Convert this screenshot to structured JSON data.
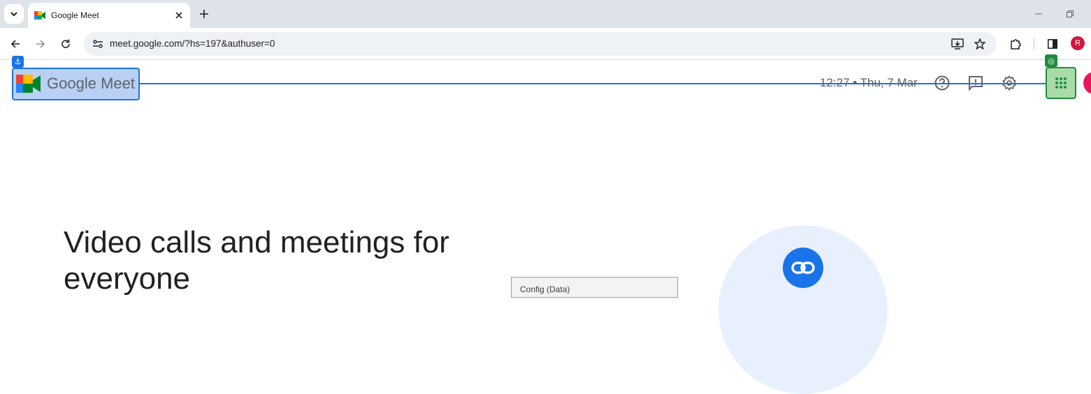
{
  "browser": {
    "tab_title": "Google Meet",
    "url": "meet.google.com/?hs=197&authuser=0",
    "profile_initial": "R"
  },
  "meet": {
    "logo_google": "Google",
    "logo_meet": "Meet",
    "clock": "12:27 • Thu, 7 Mar",
    "hero_title": "Video calls and meetings for everyone",
    "tooltip_text": "Config (Data)"
  },
  "colors": {
    "meet_green": "#00832d",
    "accent_blue": "#1a73e8",
    "avatar_red": "#d0173f"
  },
  "icons": [
    "tab-search-icon",
    "meet-favicon-icon",
    "close-icon",
    "plus-icon",
    "minimize-icon",
    "restore-icon",
    "back-icon",
    "forward-icon",
    "reload-icon",
    "site-info-icon",
    "install-icon",
    "star-icon",
    "extensions-icon",
    "side-panel-icon",
    "help-icon",
    "feedback-icon",
    "settings-icon",
    "apps-icon",
    "link-icon"
  ]
}
